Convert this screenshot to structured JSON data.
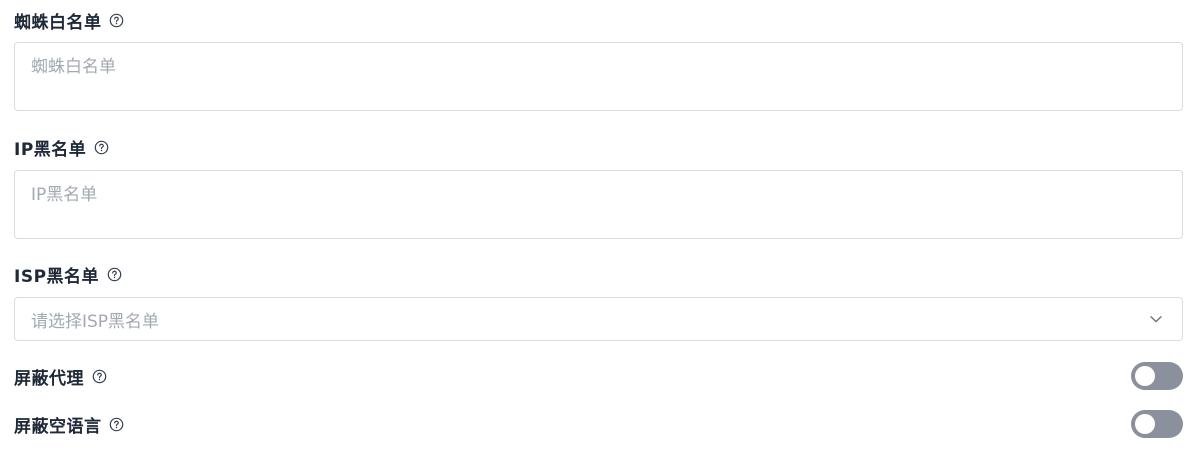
{
  "spider_whitelist": {
    "label": "蜘蛛白名单",
    "placeholder": "蜘蛛白名单",
    "help_icon": "question-circle-icon"
  },
  "ip_blacklist": {
    "label": "IP黑名单",
    "placeholder": "IP黑名单",
    "help_icon": "question-circle-icon"
  },
  "isp_blacklist": {
    "label": "ISP黑名单",
    "placeholder": "请选择ISP黑名单",
    "help_icon": "question-circle-icon",
    "dropdown_icon": "chevron-down-icon"
  },
  "block_proxy": {
    "label": "屏蔽代理",
    "enabled": false,
    "help_icon": "question-circle-icon"
  },
  "block_empty_language": {
    "label": "屏蔽空语言",
    "enabled": false,
    "help_icon": "question-circle-icon"
  },
  "colors": {
    "border": "#d9dde3",
    "placeholder": "#a3a9b3",
    "toggle_off": "#8a919c",
    "label": "#1f2937"
  }
}
